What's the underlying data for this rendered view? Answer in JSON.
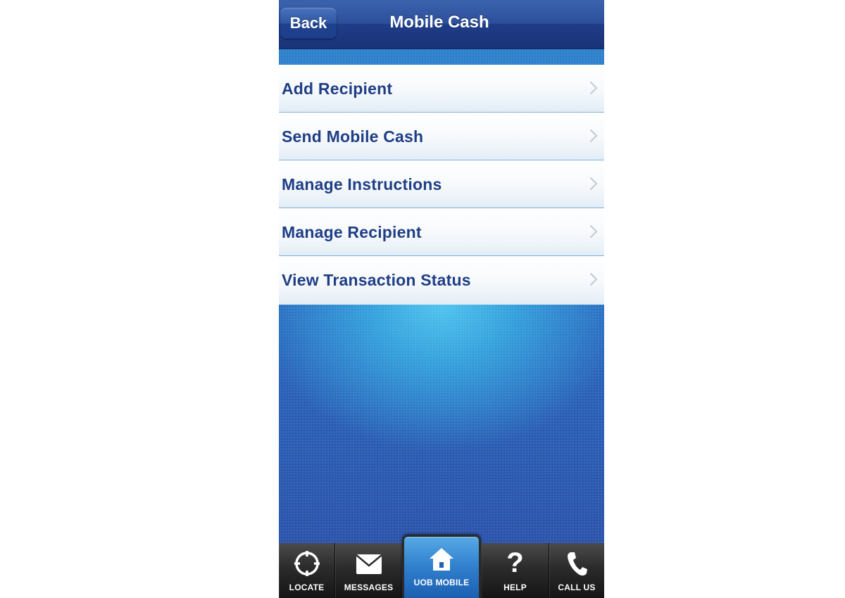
{
  "header": {
    "back_label": "Back",
    "title": "Mobile Cash"
  },
  "menu": {
    "items": [
      {
        "label": "Add Recipient",
        "icon": "chevron-right-icon"
      },
      {
        "label": "Send Mobile Cash",
        "icon": "chevron-right-icon"
      },
      {
        "label": "Manage Instructions",
        "icon": "chevron-right-icon"
      },
      {
        "label": "Manage Recipient",
        "icon": "chevron-right-icon"
      },
      {
        "label": "View Transaction Status",
        "icon": "chevron-right-icon"
      }
    ]
  },
  "tabbar": {
    "tabs": [
      {
        "label": "LOCATE",
        "icon": "crosshair-icon"
      },
      {
        "label": "MESSAGES",
        "icon": "envelope-icon"
      },
      {
        "label": "UOB MOBILE",
        "icon": "home-icon",
        "selected": true
      },
      {
        "label": "HELP",
        "icon": "question-mark-icon"
      },
      {
        "label": "CALL US",
        "icon": "phone-icon"
      }
    ]
  },
  "colors": {
    "nav_blue": "#1f3c87",
    "menu_text": "#1f3e86",
    "background_blue": "#2a66bd",
    "tab_selected": "#2f7fcd",
    "tabbar_dark": "#2b2b2b"
  }
}
